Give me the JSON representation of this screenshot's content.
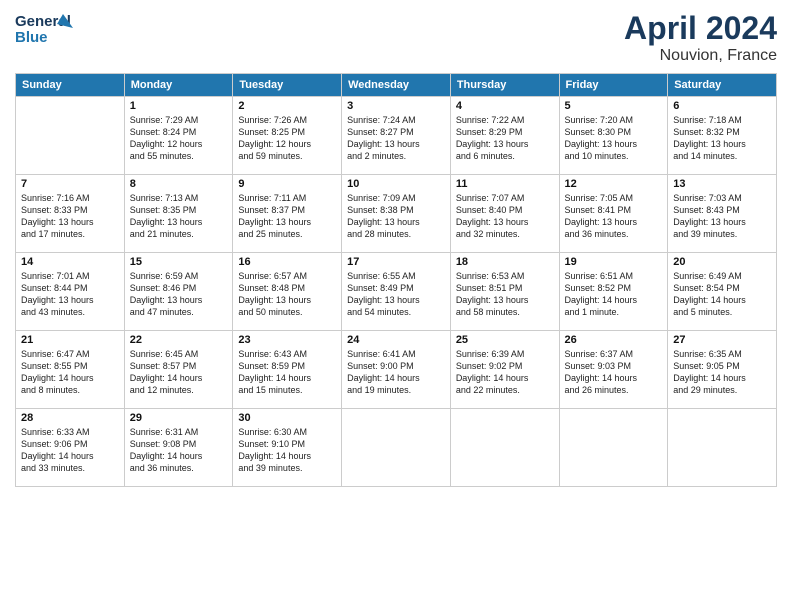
{
  "logo": {
    "line1": "General",
    "line2": "Blue"
  },
  "title": "April 2024",
  "location": "Nouvion, France",
  "weekdays": [
    "Sunday",
    "Monday",
    "Tuesday",
    "Wednesday",
    "Thursday",
    "Friday",
    "Saturday"
  ],
  "weeks": [
    [
      {
        "day": "",
        "info": ""
      },
      {
        "day": "1",
        "info": "Sunrise: 7:29 AM\nSunset: 8:24 PM\nDaylight: 12 hours\nand 55 minutes."
      },
      {
        "day": "2",
        "info": "Sunrise: 7:26 AM\nSunset: 8:25 PM\nDaylight: 12 hours\nand 59 minutes."
      },
      {
        "day": "3",
        "info": "Sunrise: 7:24 AM\nSunset: 8:27 PM\nDaylight: 13 hours\nand 2 minutes."
      },
      {
        "day": "4",
        "info": "Sunrise: 7:22 AM\nSunset: 8:29 PM\nDaylight: 13 hours\nand 6 minutes."
      },
      {
        "day": "5",
        "info": "Sunrise: 7:20 AM\nSunset: 8:30 PM\nDaylight: 13 hours\nand 10 minutes."
      },
      {
        "day": "6",
        "info": "Sunrise: 7:18 AM\nSunset: 8:32 PM\nDaylight: 13 hours\nand 14 minutes."
      }
    ],
    [
      {
        "day": "7",
        "info": "Sunrise: 7:16 AM\nSunset: 8:33 PM\nDaylight: 13 hours\nand 17 minutes."
      },
      {
        "day": "8",
        "info": "Sunrise: 7:13 AM\nSunset: 8:35 PM\nDaylight: 13 hours\nand 21 minutes."
      },
      {
        "day": "9",
        "info": "Sunrise: 7:11 AM\nSunset: 8:37 PM\nDaylight: 13 hours\nand 25 minutes."
      },
      {
        "day": "10",
        "info": "Sunrise: 7:09 AM\nSunset: 8:38 PM\nDaylight: 13 hours\nand 28 minutes."
      },
      {
        "day": "11",
        "info": "Sunrise: 7:07 AM\nSunset: 8:40 PM\nDaylight: 13 hours\nand 32 minutes."
      },
      {
        "day": "12",
        "info": "Sunrise: 7:05 AM\nSunset: 8:41 PM\nDaylight: 13 hours\nand 36 minutes."
      },
      {
        "day": "13",
        "info": "Sunrise: 7:03 AM\nSunset: 8:43 PM\nDaylight: 13 hours\nand 39 minutes."
      }
    ],
    [
      {
        "day": "14",
        "info": "Sunrise: 7:01 AM\nSunset: 8:44 PM\nDaylight: 13 hours\nand 43 minutes."
      },
      {
        "day": "15",
        "info": "Sunrise: 6:59 AM\nSunset: 8:46 PM\nDaylight: 13 hours\nand 47 minutes."
      },
      {
        "day": "16",
        "info": "Sunrise: 6:57 AM\nSunset: 8:48 PM\nDaylight: 13 hours\nand 50 minutes."
      },
      {
        "day": "17",
        "info": "Sunrise: 6:55 AM\nSunset: 8:49 PM\nDaylight: 13 hours\nand 54 minutes."
      },
      {
        "day": "18",
        "info": "Sunrise: 6:53 AM\nSunset: 8:51 PM\nDaylight: 13 hours\nand 58 minutes."
      },
      {
        "day": "19",
        "info": "Sunrise: 6:51 AM\nSunset: 8:52 PM\nDaylight: 14 hours\nand 1 minute."
      },
      {
        "day": "20",
        "info": "Sunrise: 6:49 AM\nSunset: 8:54 PM\nDaylight: 14 hours\nand 5 minutes."
      }
    ],
    [
      {
        "day": "21",
        "info": "Sunrise: 6:47 AM\nSunset: 8:55 PM\nDaylight: 14 hours\nand 8 minutes."
      },
      {
        "day": "22",
        "info": "Sunrise: 6:45 AM\nSunset: 8:57 PM\nDaylight: 14 hours\nand 12 minutes."
      },
      {
        "day": "23",
        "info": "Sunrise: 6:43 AM\nSunset: 8:59 PM\nDaylight: 14 hours\nand 15 minutes."
      },
      {
        "day": "24",
        "info": "Sunrise: 6:41 AM\nSunset: 9:00 PM\nDaylight: 14 hours\nand 19 minutes."
      },
      {
        "day": "25",
        "info": "Sunrise: 6:39 AM\nSunset: 9:02 PM\nDaylight: 14 hours\nand 22 minutes."
      },
      {
        "day": "26",
        "info": "Sunrise: 6:37 AM\nSunset: 9:03 PM\nDaylight: 14 hours\nand 26 minutes."
      },
      {
        "day": "27",
        "info": "Sunrise: 6:35 AM\nSunset: 9:05 PM\nDaylight: 14 hours\nand 29 minutes."
      }
    ],
    [
      {
        "day": "28",
        "info": "Sunrise: 6:33 AM\nSunset: 9:06 PM\nDaylight: 14 hours\nand 33 minutes."
      },
      {
        "day": "29",
        "info": "Sunrise: 6:31 AM\nSunset: 9:08 PM\nDaylight: 14 hours\nand 36 minutes."
      },
      {
        "day": "30",
        "info": "Sunrise: 6:30 AM\nSunset: 9:10 PM\nDaylight: 14 hours\nand 39 minutes."
      },
      {
        "day": "",
        "info": ""
      },
      {
        "day": "",
        "info": ""
      },
      {
        "day": "",
        "info": ""
      },
      {
        "day": "",
        "info": ""
      }
    ]
  ]
}
